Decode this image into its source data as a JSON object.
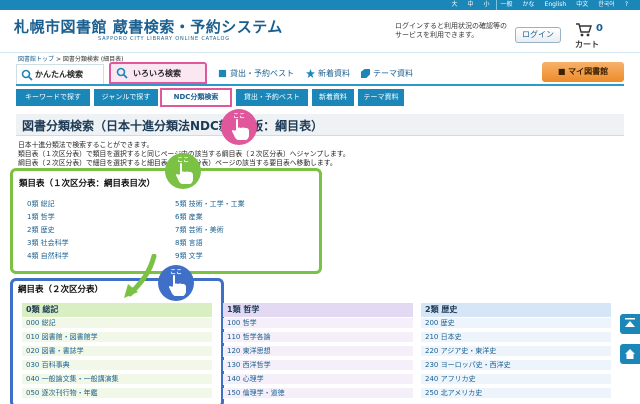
{
  "util": {
    "links": [
      "大",
      "中",
      "小",
      "一般",
      "かな",
      "English",
      "中文",
      "한국어"
    ],
    "help": "?"
  },
  "header": {
    "logo_main": "札幌市図書館 蔵書検索・予約システム",
    "logo_sub": "SAPPORO CITY LIBRARY ONLINE CATALOG",
    "login_message": "ログインすると利用状況の確認等の サービスを利用できます。",
    "login_button": "ログイン",
    "cart_count": "0",
    "cart_label": "カート"
  },
  "breadcrumb": {
    "top": "図書館トップ",
    "sep1": ">",
    "mid": "図書分類検索",
    "current": "(細目表)"
  },
  "main_tabs": {
    "simple": "かんたん検索",
    "various": "いろいろ検索",
    "best": "貸出・予約ベスト",
    "new": "新着資料",
    "theme": "テーマ資料",
    "mylib": "マイ図書館"
  },
  "sub_nav": [
    "キーワードで探す",
    "ジャンルで探す",
    "NDC分類検索",
    "貸出・予約ベスト",
    "新着資料",
    "テーマ資料"
  ],
  "page_title": "図書分類検索（日本十進分類法NDC新訂9版：綱目表）",
  "desc": [
    "日本十進分類法で検索することができます。",
    "類目表（１次区分表）で類目を選択すると同じページ内の該当する綱目表（２次区分表）へジャンプします。",
    "綱目表（２次区分表）で細目を選択すると細目表（３次区分表）ページの該当する要目表へ移動します。"
  ],
  "class1": {
    "title": "類目表（１次区分表：綱目表目次）",
    "items": [
      "0類 総記",
      "1類 哲学",
      "2類 歴史",
      "3類 社会科学",
      "4類 自然科学",
      "5類 技術・工学・工業",
      "6類 産業",
      "7類 芸術・美術",
      "8類 言語",
      "9類 文学"
    ]
  },
  "class2": {
    "title": "綱目表（２次区分表）",
    "columns": [
      {
        "head": "0類 総記",
        "rows": [
          "000 総記",
          "010 図書館・図書館学",
          "020 図書・書誌学",
          "030 百科事典",
          "040 一般論文集・一般講演集",
          "050 逐次刊行物・年鑑"
        ]
      },
      {
        "head": "1類 哲学",
        "rows": [
          "100 哲学",
          "110 哲学各論",
          "120 東洋思想",
          "130 西洋哲学",
          "140 心理学",
          "150 倫理学・道徳"
        ]
      },
      {
        "head": "2類 歴史",
        "rows": [
          "200 歴史",
          "210 日本史",
          "220 アジア史・東洋史",
          "230 ヨーロッパ史・西洋史",
          "240 アフリカ史",
          "250 北アメリカ史"
        ]
      }
    ]
  },
  "callouts": {
    "koko": "ここ"
  },
  "colors": {
    "brand_blue": "#1b86b8",
    "pink": "#e0579b",
    "green": "#7bc143",
    "blue": "#3f6fc7",
    "orange": "#ec8a2a"
  },
  "icons": [
    "magnifier-icon",
    "cart-icon",
    "hand-pointer-icon",
    "arrow-down-icon",
    "home-icon",
    "to-top-icon",
    "book-icon",
    "star-icon",
    "tag-icon",
    "bag-icon"
  ]
}
